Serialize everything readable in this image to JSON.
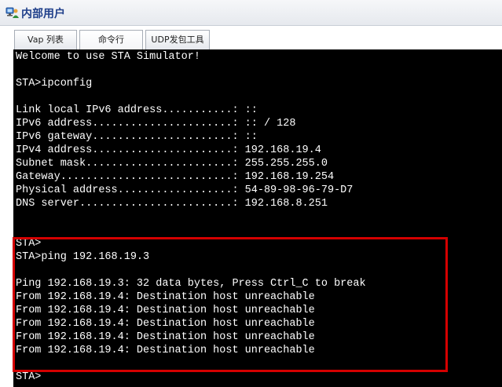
{
  "window": {
    "title": "内部用户",
    "icon": "network-user-icon"
  },
  "tabs": [
    {
      "label": "Vap 列表",
      "active": false
    },
    {
      "label": "命令行",
      "active": true
    },
    {
      "label": "UDP发包工具",
      "active": false
    }
  ],
  "terminal": {
    "lines": [
      "Welcome to use STA Simulator!",
      "",
      "STA>ipconfig",
      "",
      "Link local IPv6 address...........: ::",
      "IPv6 address......................: :: / 128",
      "IPv6 gateway......................: ::",
      "IPv4 address......................: 192.168.19.4",
      "Subnet mask.......................: 255.255.255.0",
      "Gateway...........................: 192.168.19.254",
      "Physical address..................: 54-89-98-96-79-D7",
      "DNS server........................: 192.168.8.251",
      "",
      "",
      "STA>",
      "STA>ping 192.168.19.3",
      "",
      "Ping 192.168.19.3: 32 data bytes, Press Ctrl_C to break",
      "From 192.168.19.4: Destination host unreachable",
      "From 192.168.19.4: Destination host unreachable",
      "From 192.168.19.4: Destination host unreachable",
      "From 192.168.19.4: Destination host unreachable",
      "From 192.168.19.4: Destination host unreachable",
      "",
      "STA>"
    ]
  },
  "highlight": {
    "color": "#d40000"
  }
}
